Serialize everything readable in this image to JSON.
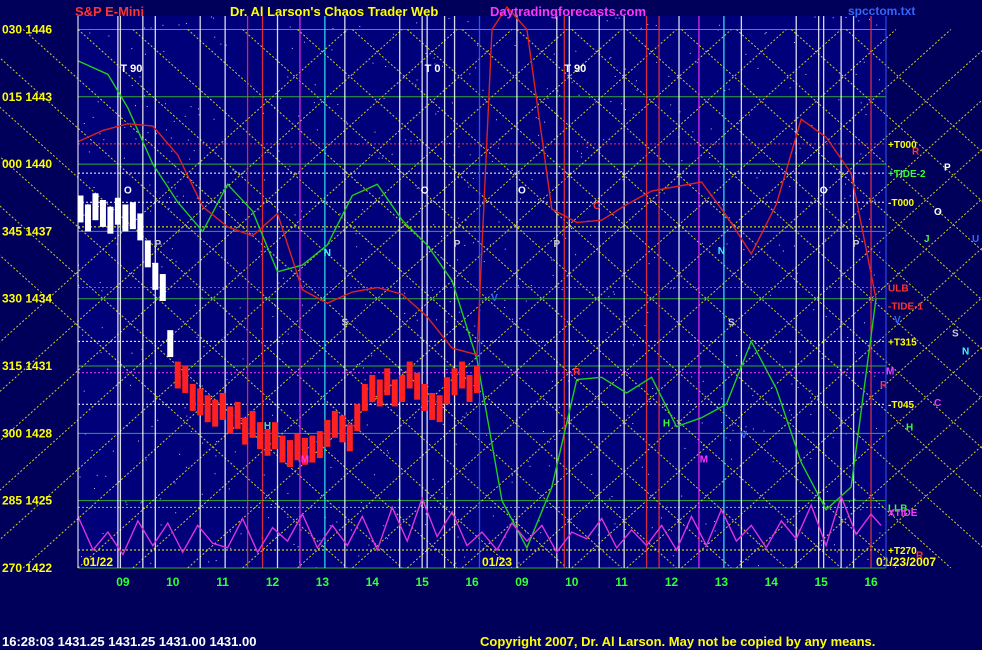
{
  "header": {
    "symbol": "S&P E-Mini",
    "symbol_color": "#ff3333",
    "author": "Dr. Al Larson's Chaos Trader Web",
    "author_color": "#ffff00",
    "site": "Daytradingforecasts.com",
    "site_color": "#ff33ff",
    "file": "spcctom.txt",
    "file_color": "#3366ff"
  },
  "footer": {
    "status": "16:28:03  1431.25  1431.25  1431.00  1431.00",
    "copyright": "Copyright 2007, Dr. Al Larson. May not be copied by any means."
  },
  "chart_data": {
    "type": "line",
    "title": "",
    "y_left_labels": [
      {
        "angle": "030",
        "price": 1446
      },
      {
        "angle": "015",
        "price": 1443
      },
      {
        "angle": "000",
        "price": 1440
      },
      {
        "angle": "345",
        "price": 1437
      },
      {
        "angle": "330",
        "price": 1434
      },
      {
        "angle": "315",
        "price": 1431
      },
      {
        "angle": "300",
        "price": 1428
      },
      {
        "angle": "285",
        "price": 1425
      },
      {
        "angle": "270",
        "price": 1422
      }
    ],
    "ylim": [
      1422,
      1446.6
    ],
    "xlim": [
      0,
      16.2
    ],
    "date_labels": [
      {
        "text": "01/22",
        "x": 0.1
      },
      {
        "text": "01/23",
        "x": 8.1
      },
      {
        "text": "01/23/2007",
        "x": 15.8
      }
    ],
    "x_ticks": [
      {
        "t": 0.9,
        "label": "09"
      },
      {
        "t": 1.9,
        "label": "10"
      },
      {
        "t": 2.9,
        "label": "11"
      },
      {
        "t": 3.9,
        "label": "12"
      },
      {
        "t": 4.9,
        "label": "13"
      },
      {
        "t": 5.9,
        "label": "14"
      },
      {
        "t": 6.9,
        "label": "15"
      },
      {
        "t": 7.9,
        "label": "16"
      },
      {
        "t": 8.9,
        "label": "09"
      },
      {
        "t": 9.9,
        "label": "10"
      },
      {
        "t": 10.9,
        "label": "11"
      },
      {
        "t": 11.9,
        "label": "12"
      },
      {
        "t": 12.9,
        "label": "13"
      },
      {
        "t": 13.9,
        "label": "14"
      },
      {
        "t": 14.9,
        "label": "15"
      },
      {
        "t": 15.9,
        "label": "16"
      }
    ],
    "right_labels": [
      {
        "text": "+T000",
        "y": 1440.9,
        "color": "#ffff00"
      },
      {
        "text": "+TIDE-2",
        "y": 1439.6,
        "color": "#33ff33"
      },
      {
        "text": "-T000",
        "y": 1438.3,
        "color": "#ffff00"
      },
      {
        "text": "ULB",
        "y": 1434.5,
        "color": "#ff3333"
      },
      {
        "text": "-TIDE-1",
        "y": 1433.7,
        "color": "#ff3333"
      },
      {
        "text": "+T315",
        "y": 1432.1,
        "color": "#ffff00"
      },
      {
        "text": "-T045",
        "y": 1429.3,
        "color": "#ffff00"
      },
      {
        "text": "LLB",
        "y": 1424.7,
        "color": "#33ff33"
      },
      {
        "text": "XTIDE",
        "y": 1424.5,
        "color": "#ff33ff"
      },
      {
        "text": "+T270",
        "y": 1422.8,
        "color": "#ffff00"
      }
    ],
    "planet_labels": [
      {
        "text": "R",
        "y": 1440.6,
        "color": "#ff3333"
      },
      {
        "text": "P",
        "y": 1439.9,
        "color": "#ffffff"
      },
      {
        "text": "O",
        "y": 1437.9,
        "color": "#ffffff"
      },
      {
        "text": "J",
        "y": 1436.7,
        "color": "#33ff33"
      },
      {
        "text": "U",
        "y": 1436.7,
        "color": "#3366ff"
      },
      {
        "text": "V",
        "y": 1433.1,
        "color": "#3366ff"
      },
      {
        "text": "S",
        "y": 1432.5,
        "color": "#cccccc"
      },
      {
        "text": "N",
        "y": 1431.7,
        "color": "#33ffff"
      },
      {
        "text": "M",
        "y": 1430.8,
        "color": "#ff33ff"
      },
      {
        "text": "R",
        "y": 1430.2,
        "color": "#ff3333"
      },
      {
        "text": "C",
        "y": 1429.4,
        "color": "#ff33ff"
      },
      {
        "text": "H",
        "y": 1428.3,
        "color": "#33ff33"
      },
      {
        "text": "R",
        "y": 1422.6,
        "color": "#ff3333"
      }
    ],
    "phase_labels": [
      {
        "text": "T 90",
        "t": 0.85,
        "y": 1444.1
      },
      {
        "text": "T 0",
        "t": 6.95,
        "y": 1444.1
      },
      {
        "text": "T 90",
        "t": 9.75,
        "y": 1444.1
      }
    ],
    "cycle_markers": [
      {
        "text": "O",
        "t": 1.0,
        "y": 1438.7,
        "color": "#ffffff"
      },
      {
        "text": "O",
        "t": 6.95,
        "y": 1438.7,
        "color": "#ffffff"
      },
      {
        "text": "O",
        "t": 8.9,
        "y": 1438.7,
        "color": "#ffffff"
      },
      {
        "text": "O",
        "t": 14.95,
        "y": 1438.7,
        "color": "#ffffff"
      },
      {
        "text": "P",
        "t": 1.6,
        "y": 1436.3,
        "color": "#cccccc"
      },
      {
        "text": "P",
        "t": 7.6,
        "y": 1436.3,
        "color": "#cccccc"
      },
      {
        "text": "P",
        "t": 9.6,
        "y": 1436.3,
        "color": "#cccccc"
      },
      {
        "text": "P",
        "t": 15.6,
        "y": 1436.3,
        "color": "#cccccc"
      },
      {
        "text": "N",
        "t": 5.0,
        "y": 1435.9,
        "color": "#33ffff"
      },
      {
        "text": "N",
        "t": 12.9,
        "y": 1436.0,
        "color": "#33ffff"
      },
      {
        "text": "S",
        "t": 5.35,
        "y": 1432.8,
        "color": "#cccccc"
      },
      {
        "text": "S",
        "t": 13.1,
        "y": 1432.8,
        "color": "#cccccc"
      },
      {
        "text": "H",
        "t": 3.8,
        "y": 1428.2,
        "color": "#33ff33"
      },
      {
        "text": "H",
        "t": 11.8,
        "y": 1428.3,
        "color": "#33ff33"
      },
      {
        "text": "M",
        "t": 4.55,
        "y": 1426.7,
        "color": "#ff33ff"
      },
      {
        "text": "M",
        "t": 12.55,
        "y": 1426.7,
        "color": "#ff33ff"
      },
      {
        "text": "V",
        "t": 13.35,
        "y": 1427.8,
        "color": "#3366ff"
      },
      {
        "text": "C",
        "t": 10.4,
        "y": 1438.0,
        "color": "#ff3333"
      },
      {
        "text": "V",
        "t": 8.35,
        "y": 1433.9,
        "color": "#3366ff"
      },
      {
        "text": "R",
        "t": 10.0,
        "y": 1430.6,
        "color": "#ff3333"
      }
    ],
    "vertical_lines": [
      {
        "t": 0.8,
        "color": "#ffffff"
      },
      {
        "t": 0.85,
        "color": "#ffffff"
      },
      {
        "t": 1.3,
        "color": "#ffffff"
      },
      {
        "t": 1.55,
        "color": "#ffffff"
      },
      {
        "t": 2.45,
        "color": "#ffffff"
      },
      {
        "t": 2.95,
        "color": "#ffffff"
      },
      {
        "t": 3.4,
        "color": "#ff3333"
      },
      {
        "t": 3.7,
        "color": "#ff3333"
      },
      {
        "t": 4.0,
        "color": "#ffffff"
      },
      {
        "t": 4.45,
        "color": "#ff33ff"
      },
      {
        "t": 4.95,
        "color": "#33ffff"
      },
      {
        "t": 5.35,
        "color": "#ffffff"
      },
      {
        "t": 6.45,
        "color": "#ffffff"
      },
      {
        "t": 6.9,
        "color": "#ffffff"
      },
      {
        "t": 7.0,
        "color": "#ffffff"
      },
      {
        "t": 7.35,
        "color": "#ffffff"
      },
      {
        "t": 7.55,
        "color": "#ffffff"
      },
      {
        "t": 8.05,
        "color": "#3366ff"
      },
      {
        "t": 8.8,
        "color": "#ffffff"
      },
      {
        "t": 9.6,
        "color": "#ffffff"
      },
      {
        "t": 9.75,
        "color": "#ff3333"
      },
      {
        "t": 9.85,
        "color": "#ffffff"
      },
      {
        "t": 10.45,
        "color": "#ffffff"
      },
      {
        "t": 10.95,
        "color": "#ffffff"
      },
      {
        "t": 11.4,
        "color": "#ff3333"
      },
      {
        "t": 11.65,
        "color": "#ff3333"
      },
      {
        "t": 12.05,
        "color": "#ffffff"
      },
      {
        "t": 12.45,
        "color": "#ff33ff"
      },
      {
        "t": 12.95,
        "color": "#33ffff"
      },
      {
        "t": 13.3,
        "color": "#ffffff"
      },
      {
        "t": 14.4,
        "color": "#ffffff"
      },
      {
        "t": 14.85,
        "color": "#ffffff"
      },
      {
        "t": 14.95,
        "color": "#ffffff"
      },
      {
        "t": 15.3,
        "color": "#ffffff"
      },
      {
        "t": 15.55,
        "color": "#ffffff"
      },
      {
        "t": 15.9,
        "color": "#ff3333"
      }
    ],
    "horizontal_lines": [
      {
        "y": 1440.9,
        "color": "#ff3333"
      },
      {
        "y": 1439.6,
        "color": "#ffffff"
      },
      {
        "y": 1438.3,
        "color": "#ffffff"
      },
      {
        "y": 1437.2,
        "color": "#ffff00"
      },
      {
        "y": 1434.5,
        "color": "#ff3333"
      },
      {
        "y": 1432.1,
        "color": "#ffffff"
      },
      {
        "y": 1430.7,
        "color": "#ff33ff"
      },
      {
        "y": 1429.3,
        "color": "#ffffff"
      },
      {
        "y": 1424.7,
        "color": "#33ff33"
      },
      {
        "y": 1422.8,
        "color": "#ffff00"
      }
    ],
    "series": [
      {
        "name": "",
        "role": "price-bars",
        "color": "#ff2020",
        "x": [
          0.05,
          0.2,
          0.35,
          0.5,
          0.65,
          0.8,
          0.95,
          1.1,
          1.25,
          1.4,
          1.55,
          1.7,
          1.85,
          2.0,
          2.15,
          2.3,
          2.45,
          2.6,
          2.75,
          2.9,
          3.05,
          3.2,
          3.35,
          3.5,
          3.65,
          3.8,
          3.95,
          4.1,
          4.25,
          4.4,
          4.55,
          4.7,
          4.85,
          5.0,
          5.15,
          5.3,
          5.45,
          5.6,
          5.75,
          5.9,
          6.05,
          6.2,
          6.35,
          6.5,
          6.65,
          6.8,
          6.95,
          7.1,
          7.25,
          7.4,
          7.55,
          7.7,
          7.85,
          8.0
        ],
        "values": [
          1438.0,
          1437.6,
          1438.1,
          1437.8,
          1437.5,
          1437.9,
          1437.6,
          1437.7,
          1437.2,
          1436.0,
          1435.0,
          1434.5,
          1432.0,
          1430.6,
          1430.4,
          1429.6,
          1429.4,
          1429.1,
          1428.9,
          1429.2,
          1428.6,
          1428.8,
          1428.1,
          1428.4,
          1427.9,
          1427.6,
          1427.9,
          1427.3,
          1427.1,
          1427.4,
          1427.2,
          1427.3,
          1427.5,
          1428.0,
          1428.4,
          1428.2,
          1427.8,
          1428.7,
          1429.6,
          1430.0,
          1429.8,
          1430.3,
          1429.8,
          1430.0,
          1430.6,
          1430.1,
          1429.6,
          1429.2,
          1429.1,
          1429.9,
          1430.3,
          1430.6,
          1430.0,
          1430.4
        ]
      },
      {
        "name": "",
        "role": "green-cycle",
        "color": "#22cc22",
        "x": [
          0.0,
          0.6,
          1.0,
          1.5,
          2.0,
          2.5,
          3.0,
          3.5,
          4.0,
          4.5,
          5.0,
          5.5,
          6.0,
          6.5,
          7.0,
          7.5,
          8.0,
          8.5,
          9.0,
          9.5,
          10.0,
          10.5,
          11.0,
          11.5,
          12.0,
          12.5,
          13.0,
          13.5,
          14.0,
          14.5,
          15.0,
          15.5,
          16.0
        ],
        "values": [
          1444.6,
          1444.0,
          1442.5,
          1440.0,
          1438.3,
          1437.0,
          1439.1,
          1437.9,
          1435.2,
          1435.5,
          1436.4,
          1438.6,
          1439.1,
          1437.5,
          1436.4,
          1434.8,
          1431.3,
          1425.0,
          1422.9,
          1425.6,
          1430.4,
          1430.5,
          1429.8,
          1430.5,
          1428.3,
          1428.7,
          1429.3,
          1432.1,
          1430.0,
          1426.7,
          1424.6,
          1425.6,
          1434.0
        ]
      },
      {
        "name": "",
        "role": "red-cycle",
        "color": "#dd2222",
        "x": [
          0.0,
          0.5,
          1.0,
          1.5,
          2.0,
          2.5,
          3.0,
          3.5,
          4.0,
          4.5,
          5.0,
          5.5,
          6.0,
          6.5,
          7.0,
          7.5,
          8.0,
          8.3,
          8.6,
          9.0,
          9.5,
          10.0,
          10.5,
          11.0,
          11.5,
          12.0,
          12.5,
          13.0,
          13.5,
          14.0,
          14.5,
          15.0,
          15.5,
          16.0
        ],
        "values": [
          1441.0,
          1441.5,
          1441.8,
          1441.7,
          1440.4,
          1438.1,
          1437.2,
          1436.8,
          1437.8,
          1434.4,
          1433.8,
          1434.3,
          1434.5,
          1434.2,
          1433.2,
          1431.8,
          1431.5,
          1446.0,
          1447.0,
          1446.0,
          1438.0,
          1437.4,
          1437.5,
          1438.2,
          1438.8,
          1439.0,
          1439.2,
          1437.7,
          1436.0,
          1438.2,
          1442.0,
          1441.2,
          1439.6,
          1434.0
        ]
      },
      {
        "name": "",
        "role": "xtide",
        "color": "#dd33dd",
        "x": [
          0.0,
          0.3,
          0.6,
          0.9,
          1.2,
          1.5,
          1.8,
          2.1,
          2.4,
          2.7,
          3.0,
          3.3,
          3.6,
          3.9,
          4.2,
          4.5,
          4.8,
          5.1,
          5.4,
          5.7,
          6.0,
          6.3,
          6.6,
          6.9,
          7.2,
          7.5,
          7.8,
          8.1,
          8.4,
          8.7,
          9.0,
          9.3,
          9.6,
          9.9,
          10.2,
          10.5,
          10.8,
          11.1,
          11.4,
          11.7,
          12.0,
          12.3,
          12.6,
          12.9,
          13.2,
          13.5,
          13.8,
          14.1,
          14.4,
          14.7,
          15.0,
          15.3,
          15.6,
          15.9,
          16.1
        ],
        "values": [
          1424.3,
          1422.8,
          1423.6,
          1422.6,
          1424.1,
          1423.0,
          1424.0,
          1422.7,
          1423.9,
          1423.1,
          1422.9,
          1424.2,
          1422.7,
          1423.8,
          1423.2,
          1424.4,
          1422.9,
          1423.9,
          1423.0,
          1424.3,
          1422.8,
          1424.7,
          1423.2,
          1425.1,
          1423.4,
          1424.5,
          1423.0,
          1423.6,
          1422.8,
          1424.0,
          1423.2,
          1423.9,
          1422.7,
          1423.6,
          1423.3,
          1424.2,
          1422.9,
          1423.7,
          1423.0,
          1423.9,
          1422.8,
          1424.3,
          1423.0,
          1424.6,
          1423.2,
          1423.9,
          1422.9,
          1424.1,
          1423.3,
          1424.8,
          1423.0,
          1425.2,
          1423.5,
          1424.4,
          1423.9
        ]
      }
    ],
    "grid": true
  }
}
